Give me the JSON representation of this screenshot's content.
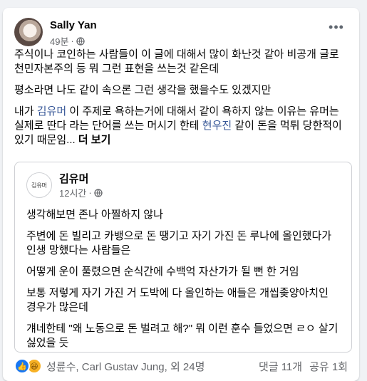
{
  "post": {
    "author": "Sally Yan",
    "time": "49분",
    "paragraphs": [
      "주식이나 코인하는 사람들이 이 글에 대해서 많이 화난것 같아 비공개 글로 천민자본주의 등 뭐 그런 표현을 쓰는것 같은데",
      "평소라면 나도 같이 속으론 그런 생각을 했을수도 있겠지만"
    ],
    "p3": {
      "pre": "내가 ",
      "tag1": "김유머",
      "mid": " 이 주제로 욕하는거에 대해서 같이 욕하지 않는 이유는 유머는 실제로 딴다 라는 단어를 쓰는 머시기 한테 ",
      "tag2": "현우진",
      "post": " 같이 돈을 먹튀 당한적이 있기 때문임... ",
      "see_more": "더 보기"
    }
  },
  "shared": {
    "avatar_text": "김유머",
    "author": "김유머",
    "time": "12시간",
    "paragraphs": [
      "생각해보면 존나 아찔하지 않나",
      "주변에 돈 빌리고 카뱅으로 돈 땡기고 자기 가진 돈 루나에 올인했다가 인생 망했다는 사람들은",
      "어떻게 운이 풀렸으면 순식간에 수백억 자산가가 될 뻔 한 거임",
      "보통 저렇게 자기 가진 거 도박에 다 올인하는 애들은 개씹좆양아치인 경우가 많은데",
      "걔네한테 \"왜 노동으로 돈 벌려고 해?\" 뭐 이런 훈수 들었으면 ㄹㅇ 살기 싫었을 듯"
    ]
  },
  "footer": {
    "reactors": "성륜수, Carl Gustav Jung, 외 24명",
    "comments": "댓글 11개",
    "shares": "공유 1회"
  },
  "icons": {
    "more": "more-horizontal-icon",
    "audience": "globe-icon",
    "like": "like-reaction-icon",
    "haha": "haha-reaction-icon"
  }
}
